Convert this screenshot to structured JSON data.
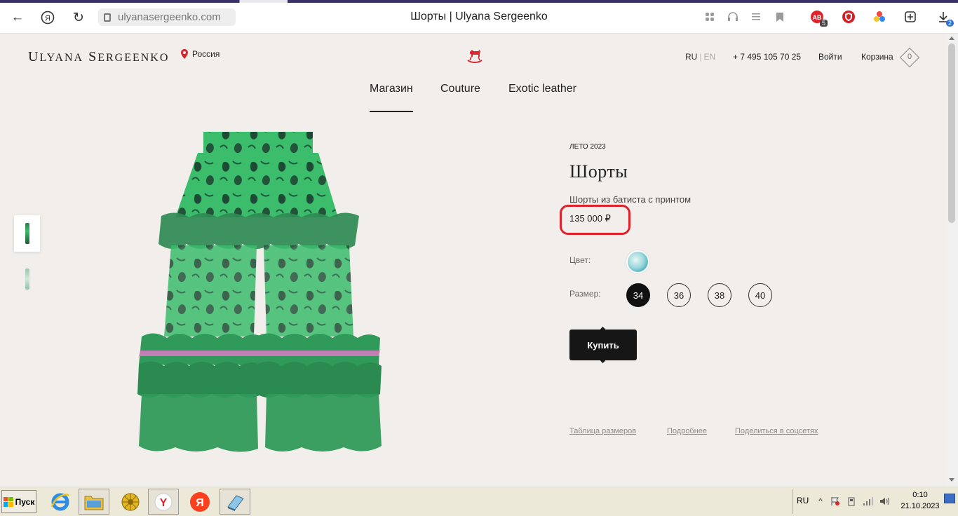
{
  "browser": {
    "url": "ulyanasergeenko.com",
    "tab_title": "Шорты | Ulyana Sergeenko",
    "downloads_badge": "2",
    "ext_badge": "5"
  },
  "site": {
    "logo_first": "U",
    "logo_first_rest": "LYANA",
    "logo_second": "S",
    "logo_second_rest": "ERGEENKO",
    "region": "Россия",
    "lang_ru": "RU",
    "lang_sep": "|",
    "lang_en": "EN",
    "phone": "+ 7 495 105 70 25",
    "login": "Войти",
    "cart_label": "Корзина",
    "cart_count": "0"
  },
  "nav": {
    "items": [
      {
        "label": "Магазин",
        "active": true
      },
      {
        "label": "Couture",
        "active": false
      },
      {
        "label": "Exotic leather",
        "active": false
      }
    ]
  },
  "product": {
    "season": "ЛЕТО 2023",
    "title": "Шорты",
    "description": "Шорты из батиста с принтом",
    "price": "135 000 ₽",
    "color_label": "Цвет:",
    "size_label": "Размер:",
    "sizes": [
      "34",
      "36",
      "38",
      "40"
    ],
    "selected_size": "34",
    "buy_label": "Купить",
    "links": [
      "Таблица размеров",
      "Подробнее",
      "Поделиться в соцсетях"
    ]
  },
  "taskbar": {
    "start_label": "Пуск",
    "lang": "RU",
    "time": "0:10",
    "date": "21.10.2023"
  },
  "colors": {
    "accent_red": "#e0232b",
    "page_bg": "#f2eeeb",
    "button_dark": "#161616",
    "garment_green": "#37c06a"
  }
}
